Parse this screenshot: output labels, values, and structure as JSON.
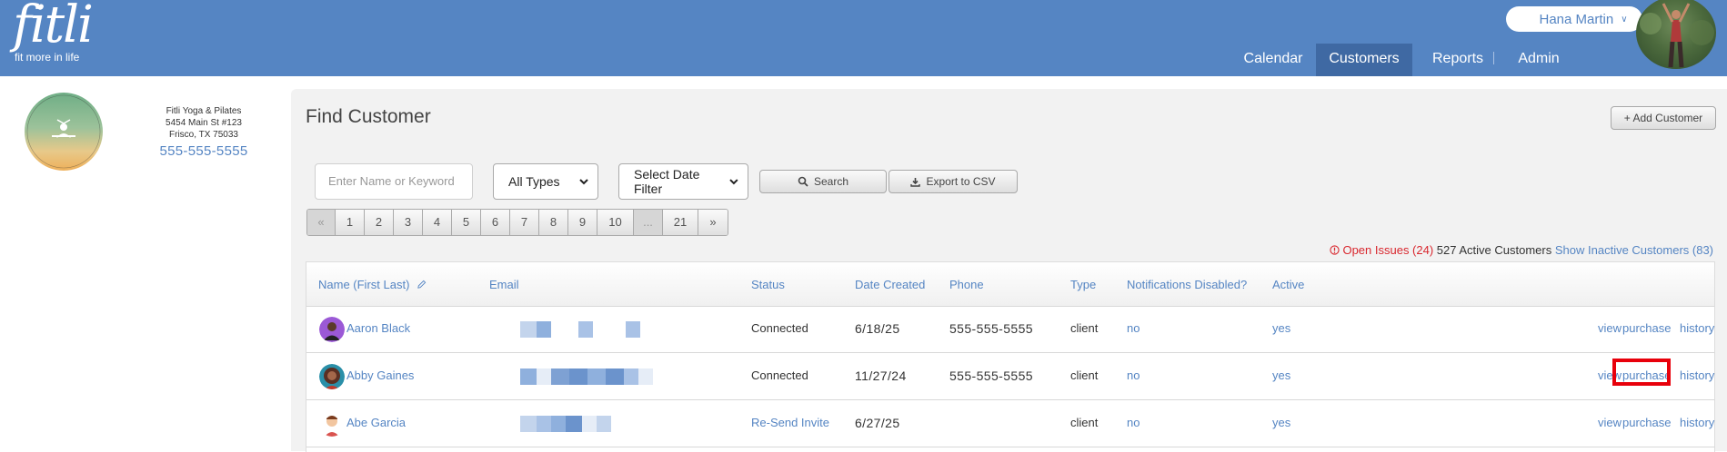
{
  "header": {
    "brand": "fitli",
    "tagline": "fit more in life",
    "user_name": "Hana Martin",
    "nav": [
      {
        "label": "Calendar",
        "active": false
      },
      {
        "label": "Customers",
        "active": true
      },
      {
        "label": "Reports",
        "active": false
      },
      {
        "label": "Admin",
        "active": false
      }
    ]
  },
  "studio": {
    "logo_text": "FITLI YOGA & PILATES",
    "name": "Fitli Yoga & Pilates",
    "address1": "5454 Main St #123",
    "address2": "Frisco, TX 75033",
    "phone": "555-555-5555"
  },
  "find": {
    "title": "Find Customer",
    "add_button": "+ Add Customer",
    "search_placeholder": "Enter Name or Keyword",
    "type_select": "All Types",
    "date_select": "Select Date Filter",
    "search_button": "Search",
    "export_button": "Export to CSV"
  },
  "pagination": [
    "«",
    "1",
    "2",
    "3",
    "4",
    "5",
    "6",
    "7",
    "8",
    "9",
    "10",
    "...",
    "21",
    "»"
  ],
  "summary": {
    "open_issues": "Open Issues (24)",
    "active_customers": "527 Active Customers",
    "inactive_link": "Show Inactive Customers (83)"
  },
  "table": {
    "columns": [
      "Name (First Last)",
      "Email",
      "Status",
      "Date Created",
      "Phone",
      "Type",
      "Notifications Disabled?",
      "Active"
    ],
    "rows": [
      {
        "name": "Aaron Black",
        "status": "Connected",
        "date_created": "6/18/25",
        "phone": "555-555-5555",
        "type": "client",
        "notifications_disabled": "no",
        "active": "yes",
        "actions": [
          "view",
          "purchase",
          "history"
        ]
      },
      {
        "name": "Abby Gaines",
        "status": "Connected",
        "date_created": "11/27/24",
        "phone": "555-555-5555",
        "type": "client",
        "notifications_disabled": "no",
        "active": "yes",
        "actions": [
          "view",
          "purchase",
          "history"
        ]
      },
      {
        "name": "Abe Garcia",
        "status": "Re-Send Invite",
        "date_created": "6/27/25",
        "phone": "",
        "type": "client",
        "notifications_disabled": "no",
        "active": "yes",
        "actions": [
          "view",
          "purchase",
          "history"
        ]
      }
    ]
  },
  "colors": {
    "brand_blue": "#5585c3",
    "nav_active": "#3f69a3",
    "issues_red": "#d9272e",
    "highlight_red": "#e8000b"
  }
}
